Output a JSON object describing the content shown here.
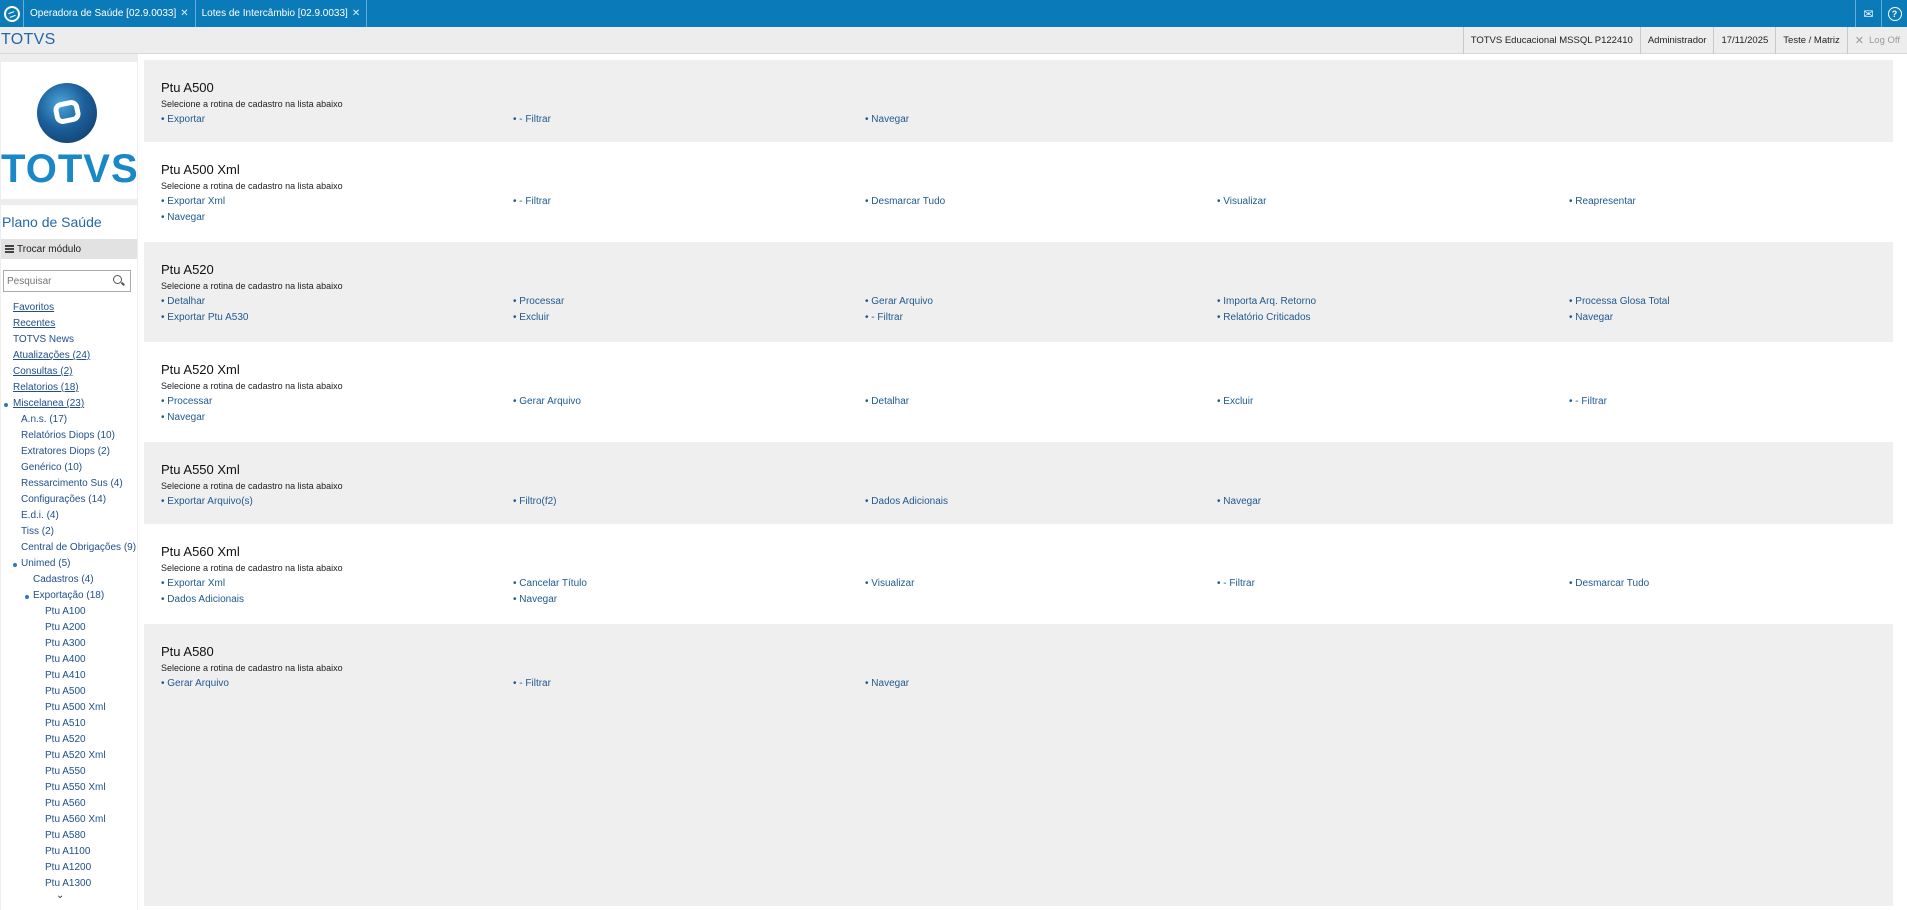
{
  "tabs": [
    {
      "label": "Operadora de Saúde [02.9.0033]"
    },
    {
      "label": "Lotes de Intercâmbio [02.9.0033]"
    }
  ],
  "header": {
    "brand": "TOTVS",
    "environment": "TOTVS Educacional MSSQL P122410",
    "user": "Administrador",
    "date": "17/11/2025",
    "company": "Teste / Matriz",
    "logoff": "Log Off"
  },
  "sidebar": {
    "logo_text": "TOTVS",
    "module_title": "Plano de Saúde",
    "switch_module": "Trocar módulo",
    "search_placeholder": "Pesquisar",
    "items": [
      {
        "label": "Favoritos",
        "level": 0
      },
      {
        "label": "Recentes",
        "level": 0
      },
      {
        "label": "TOTVS News",
        "level": 0
      },
      {
        "label": "Atualizações (24)",
        "level": 0
      },
      {
        "label": "Consultas (2)",
        "level": 0
      },
      {
        "label": "Relatorios (18)",
        "level": 0
      },
      {
        "label": "Miscelanea (23)",
        "level": 0
      },
      {
        "label": "A.n.s. (17)",
        "level": 1
      },
      {
        "label": "Relatórios Diops (10)",
        "level": 1
      },
      {
        "label": "Extratores Diops (2)",
        "level": 1
      },
      {
        "label": "Genérico (10)",
        "level": 1
      },
      {
        "label": "Ressarcimento Sus (4)",
        "level": 1
      },
      {
        "label": "Configurações (14)",
        "level": 1
      },
      {
        "label": "E.d.i. (4)",
        "level": 1
      },
      {
        "label": "Tiss (2)",
        "level": 1
      },
      {
        "label": "Central de Obrigações (9)",
        "level": 1
      },
      {
        "label": "Unimed (5)",
        "level": 1
      },
      {
        "label": "Cadastros (4)",
        "level": 2
      },
      {
        "label": "Exportação (18)",
        "level": 2
      },
      {
        "label": "Ptu A100",
        "level": 3
      },
      {
        "label": "Ptu A200",
        "level": 3
      },
      {
        "label": "Ptu A300",
        "level": 3
      },
      {
        "label": "Ptu A400",
        "level": 3
      },
      {
        "label": "Ptu A410",
        "level": 3
      },
      {
        "label": "Ptu A500",
        "level": 3
      },
      {
        "label": "Ptu A500 Xml",
        "level": 3
      },
      {
        "label": "Ptu A510",
        "level": 3
      },
      {
        "label": "Ptu A520",
        "level": 3
      },
      {
        "label": "Ptu A520 Xml",
        "level": 3
      },
      {
        "label": "Ptu A550",
        "level": 3
      },
      {
        "label": "Ptu A550 Xml",
        "level": 3
      },
      {
        "label": "Ptu A560",
        "level": 3
      },
      {
        "label": "Ptu A560 Xml",
        "level": 3
      },
      {
        "label": "Ptu A580",
        "level": 3
      },
      {
        "label": "Ptu A1100",
        "level": 3
      },
      {
        "label": "Ptu A1200",
        "level": 3
      },
      {
        "label": "Ptu A1300",
        "level": 3
      }
    ]
  },
  "groups": [
    {
      "title": "Ptu A500",
      "subtitle": "Selecione a rotina de cadastro na lista abaixo",
      "links": [
        "Exportar",
        " - Filtrar",
        "Navegar"
      ]
    },
    {
      "title": "Ptu A500 Xml",
      "subtitle": "Selecione a rotina de cadastro na lista abaixo",
      "links": [
        "Exportar Xml",
        " - Filtrar",
        "Desmarcar Tudo",
        "Visualizar",
        "Reapresentar",
        "Navegar"
      ]
    },
    {
      "title": "Ptu A520",
      "subtitle": "Selecione a rotina de cadastro na lista abaixo",
      "links": [
        "Detalhar",
        "Processar",
        "Gerar Arquivo",
        "Importa Arq. Retorno",
        "Processa Glosa Total",
        "Exportar Ptu A530",
        "Excluir",
        " - Filtrar",
        "Relatório Criticados",
        "Navegar"
      ]
    },
    {
      "title": "Ptu A520 Xml",
      "subtitle": "Selecione a rotina de cadastro na lista abaixo",
      "links": [
        "Processar",
        "Gerar Arquivo",
        "Detalhar",
        "Excluir",
        " - Filtrar",
        "Navegar"
      ]
    },
    {
      "title": "Ptu A550 Xml",
      "subtitle": "Selecione a rotina de cadastro na lista abaixo",
      "links": [
        "Exportar Arquivo(s)",
        "Filtro(f2)",
        "Dados Adicionais",
        "Navegar"
      ]
    },
    {
      "title": "Ptu A560 Xml",
      "subtitle": "Selecione a rotina de cadastro na lista abaixo",
      "links": [
        "Exportar Xml",
        "Cancelar Título",
        "Visualizar",
        " - Filtrar",
        "Desmarcar Tudo",
        "Dados Adicionais",
        "Navegar"
      ]
    },
    {
      "title": "Ptu A580",
      "subtitle": "Selecione a rotina de cadastro na lista abaixo",
      "links": [
        "Gerar Arquivo",
        " - Filtrar",
        "Navegar"
      ]
    }
  ],
  "colors": {
    "accent": "#0b7ab8",
    "link": "#1f5a8f",
    "brand": "#1a88c6"
  }
}
